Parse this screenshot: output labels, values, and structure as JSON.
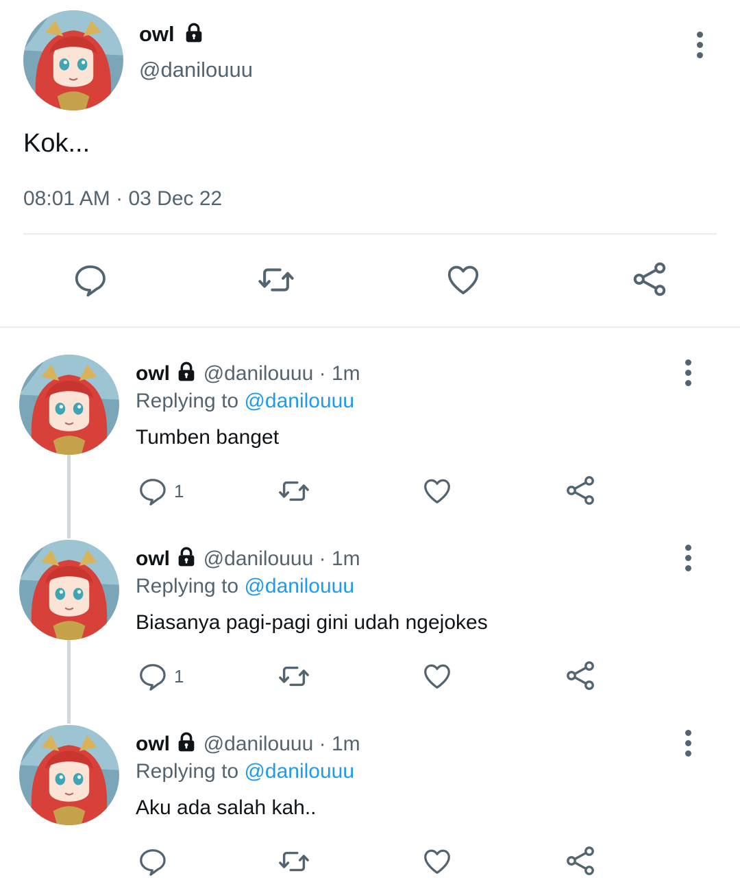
{
  "main_tweet": {
    "display_name": "owl",
    "handle": "@danilouuu",
    "text": "Kok...",
    "time": "08:01 AM",
    "separator": "·",
    "date": "03 Dec 22"
  },
  "replies": [
    {
      "display_name": "owl",
      "handle": "@danilouuu",
      "time_ago": "1m",
      "separator": "·",
      "replying_prefix": "Replying to",
      "replying_to": "@danilouuu",
      "text": "Tumben banget",
      "reply_count": "1"
    },
    {
      "display_name": "owl",
      "handle": "@danilouuu",
      "time_ago": "1m",
      "separator": "·",
      "replying_prefix": "Replying to",
      "replying_to": "@danilouuu",
      "text": "Biasanya pagi-pagi gini udah ngejokes",
      "reply_count": "1"
    },
    {
      "display_name": "owl",
      "handle": "@danilouuu",
      "time_ago": "1m",
      "separator": "·",
      "replying_prefix": "Replying to",
      "replying_to": "@danilouuu",
      "text": "Aku ada salah kah..",
      "reply_count": ""
    }
  ],
  "icons": {
    "reply": "speech-bubble-icon",
    "retweet": "retweet-icon",
    "like": "heart-icon",
    "share": "share-icon",
    "more": "more-vertical-icon",
    "protected": "lock-icon"
  },
  "colors": {
    "text": "#0f1419",
    "secondary": "#536471",
    "link": "#1d9bf0",
    "divider": "#e6ecf0",
    "thread_line": "#cfd9de"
  }
}
